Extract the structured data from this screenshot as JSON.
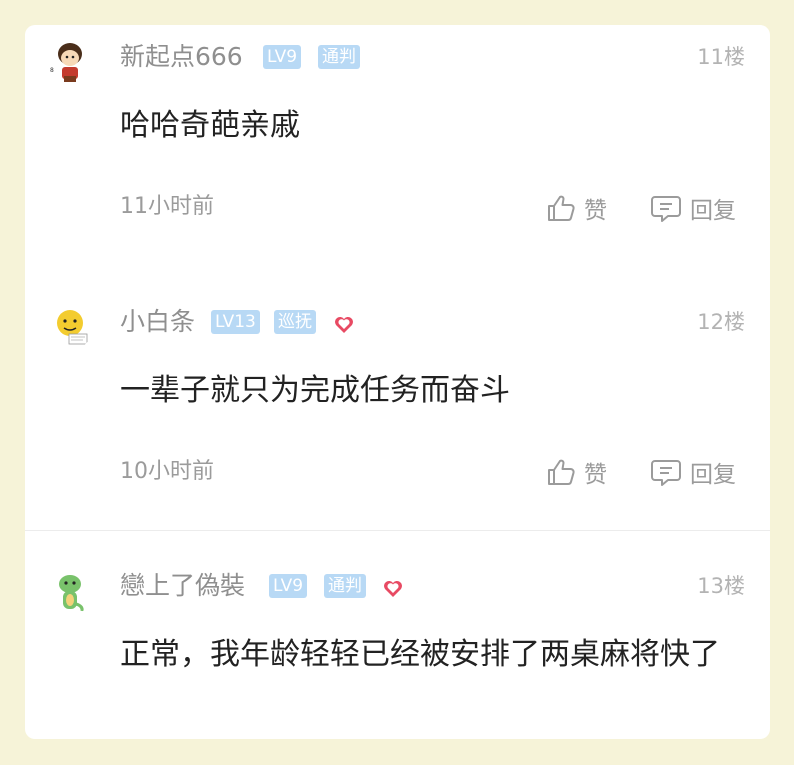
{
  "comments": [
    {
      "username": "新起点666",
      "level": "LV9",
      "role": "通判",
      "heart": false,
      "floor": "11楼",
      "content": "哈哈奇葩亲戚",
      "time": "11小时前",
      "like_label": "赞",
      "reply_label": "回复"
    },
    {
      "username": "小白条",
      "level": "LV13",
      "role": "巡抚",
      "heart": true,
      "floor": "12楼",
      "content": "一辈子就只为完成任务而奋斗",
      "time": "10小时前",
      "like_label": "赞",
      "reply_label": "回复"
    },
    {
      "username": "戀上了偽裝",
      "level": "LV9",
      "role": "通判",
      "heart": true,
      "floor": "13楼",
      "content": "正常，我年龄轻轻已经被安排了两桌麻将快了"
    }
  ],
  "colors": {
    "badge_bg": "#b8d9f5",
    "heart": "#e84a63",
    "background": "#f6f3d8"
  }
}
